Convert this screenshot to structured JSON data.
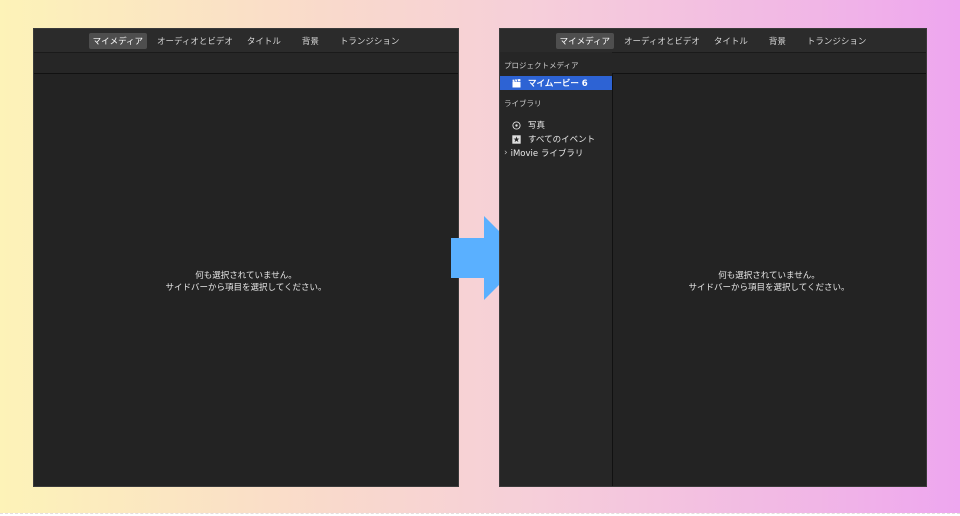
{
  "tabs": [
    {
      "label": "マイメディア",
      "active": true
    },
    {
      "label": "オーディオとビデオ",
      "active": false
    },
    {
      "label": "タイトル",
      "active": false
    },
    {
      "label": "背景",
      "active": false
    },
    {
      "label": "トランジション",
      "active": false
    }
  ],
  "empty_message": {
    "line1": "何も選択されていません。",
    "line2": "サイドバーから項目を選択してください。"
  },
  "sidebar": {
    "project_media_header": "プロジェクトメディア",
    "project_item": "マイムービー 6",
    "library_header": "ライブラリ",
    "items": [
      {
        "label": "写真",
        "icon": "photos-icon"
      },
      {
        "label": "すべてのイベント",
        "icon": "star-icon"
      }
    ],
    "imovie_library": "iMovie ライブラリ"
  },
  "colors": {
    "selection": "#2d63d4",
    "arrow": "#5ab0ff",
    "panel_bg": "#232323"
  }
}
